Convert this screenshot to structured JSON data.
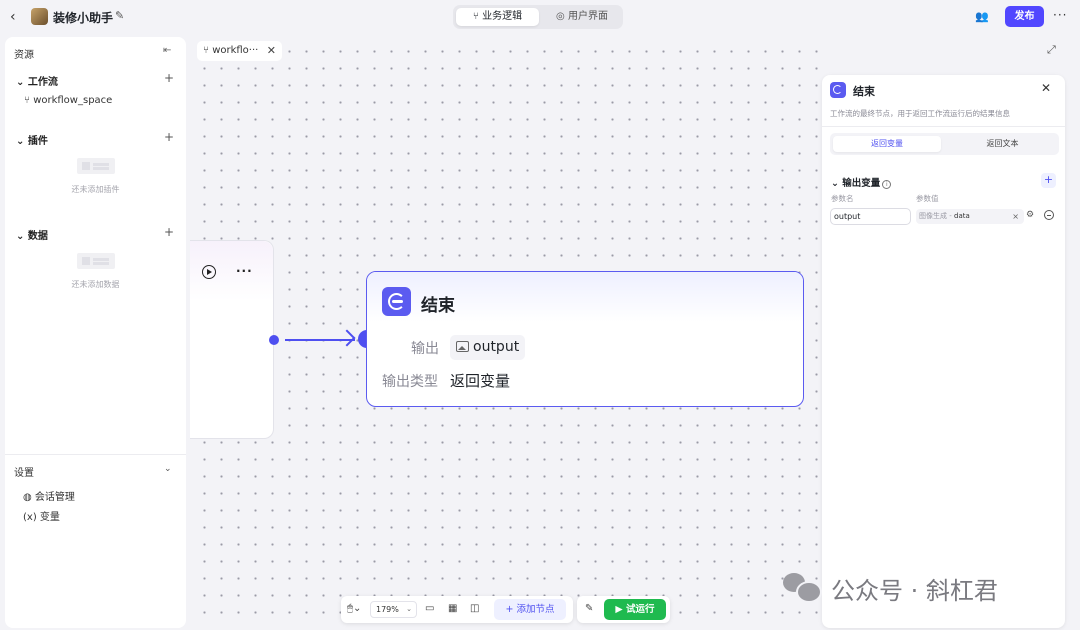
{
  "header": {
    "back_icon": "chevron-left-icon",
    "app_title": "装修小助手",
    "modes": [
      {
        "label": "业务逻辑",
        "active": true
      },
      {
        "label": "用户界面",
        "active": false
      }
    ],
    "publish_label": "发布"
  },
  "sidebar": {
    "title": "资源",
    "sections": [
      {
        "label": "工作流",
        "items": [
          "workflow_space"
        ]
      },
      {
        "label": "插件",
        "empty_text": "还未添加插件"
      },
      {
        "label": "数据",
        "empty_text": "还未添加数据"
      }
    ],
    "settings": {
      "label": "设置",
      "items": [
        {
          "icon": "chat-icon",
          "label": "会话管理"
        },
        {
          "icon": "variable-icon",
          "label": "变量",
          "glyph": "(x)"
        }
      ]
    }
  },
  "canvas": {
    "tab_label": "workflo···",
    "end_node": {
      "title": "结束",
      "output_label": "输出",
      "output_value": "output",
      "type_label": "输出类型",
      "type_value": "返回变量"
    }
  },
  "panel": {
    "title": "结束",
    "description": "工作流的最终节点，用于返回工作流运行后的结果信息",
    "tabs": [
      {
        "label": "返回变量",
        "active": true
      },
      {
        "label": "返回文本",
        "active": false
      }
    ],
    "section_title": "输出变量",
    "col_name": "参数名",
    "col_value": "参数值",
    "param_name": "output",
    "param_source": "图像生成 -",
    "param_field": "data"
  },
  "toolbar": {
    "zoom": "179%",
    "add_node_label": "添加节点",
    "run_label": "试运行"
  },
  "watermark": "公众号 · 斜杠君",
  "colors": {
    "accent": "#5147ff",
    "node_border": "#5b5bf0",
    "run": "#1fba4f"
  }
}
